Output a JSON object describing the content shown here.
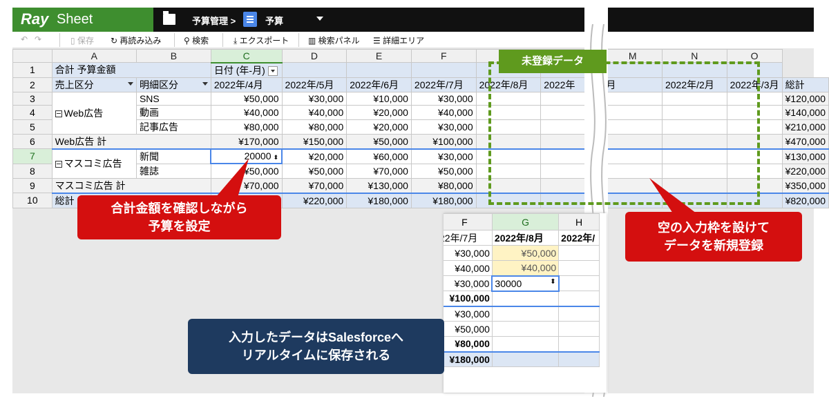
{
  "app": {
    "brand_ray": "Ray",
    "brand_sheet": "Sheet",
    "crumb_folder": "予算管理",
    "crumb_sep": ">",
    "crumb_doc": "予算"
  },
  "toolbar": {
    "undo": "↶",
    "redo": "↷",
    "save": "保存",
    "reload": "再読み込み",
    "search": "検索",
    "export": "エクスポート",
    "search_panel": "検索パネル",
    "detail_area": "詳細エリア"
  },
  "columns": [
    "A",
    "B",
    "C",
    "D",
    "E",
    "F",
    "M",
    "N",
    "O"
  ],
  "rownums": [
    "1",
    "2",
    "3",
    "4",
    "5",
    "6",
    "7",
    "8",
    "9",
    "10"
  ],
  "sheet": {
    "r1a": "合計 予算金額",
    "r1c": "日付 (年-月)",
    "r2": [
      "売上区分",
      "明細区分",
      "2022年/4月",
      "2022年/5月",
      "2022年/6月",
      "2022年/7月",
      "2022年/8月",
      "2022年",
      "月",
      "2022年/2月",
      "2022年/3月",
      "総計"
    ],
    "web": "Web広告",
    "sns": "SNS",
    "video": "動画",
    "article": "記事広告",
    "web_total": "Web広告 計",
    "mass": "マスコミ広告",
    "news": "新聞",
    "mag": "雑誌",
    "mass_total": "マスコミ広告 計",
    "grand": "総計",
    "rows": {
      "r3": [
        "¥50,000",
        "¥30,000",
        "¥10,000",
        "¥30,000",
        "¥120,000"
      ],
      "r4": [
        "¥40,000",
        "¥40,000",
        "¥20,000",
        "¥40,000",
        "¥140,000"
      ],
      "r5": [
        "¥80,000",
        "¥80,000",
        "¥20,000",
        "¥30,000",
        "¥210,000"
      ],
      "r6": [
        "¥170,000",
        "¥150,000",
        "¥50,000",
        "¥100,000",
        "¥470,000"
      ],
      "r7": [
        "20000",
        "¥20,000",
        "¥60,000",
        "¥30,000",
        "¥130,000"
      ],
      "r8": [
        "¥50,000",
        "¥50,000",
        "¥70,000",
        "¥50,000",
        "¥220,000"
      ],
      "r9": [
        "¥70,000",
        "¥70,000",
        "¥130,000",
        "¥80,000",
        "¥350,000"
      ],
      "r10": [
        "00",
        "¥220,000",
        "¥180,000",
        "¥180,000",
        "¥820,000"
      ]
    }
  },
  "annot": {
    "tag": "未登録データ",
    "c1": [
      "合計金額を確認しながら",
      "予算を設定"
    ],
    "c2": [
      "空の入力枠を設けて",
      "データを新規登録"
    ],
    "c3": [
      "入力したデータはSalesforceへ",
      "リアルタイムに保存される"
    ]
  },
  "zoom": {
    "cols": [
      "F",
      "G",
      "H"
    ],
    "hdr": [
      "22年/7月",
      "2022年/8月",
      "2022年/"
    ],
    "f": [
      "¥30,000",
      "¥40,000",
      "¥30,000",
      "¥100,000",
      "¥30,000",
      "¥50,000",
      "¥80,000",
      "¥180,000"
    ],
    "g": [
      "¥50,000",
      "¥40,000",
      "30000"
    ]
  }
}
